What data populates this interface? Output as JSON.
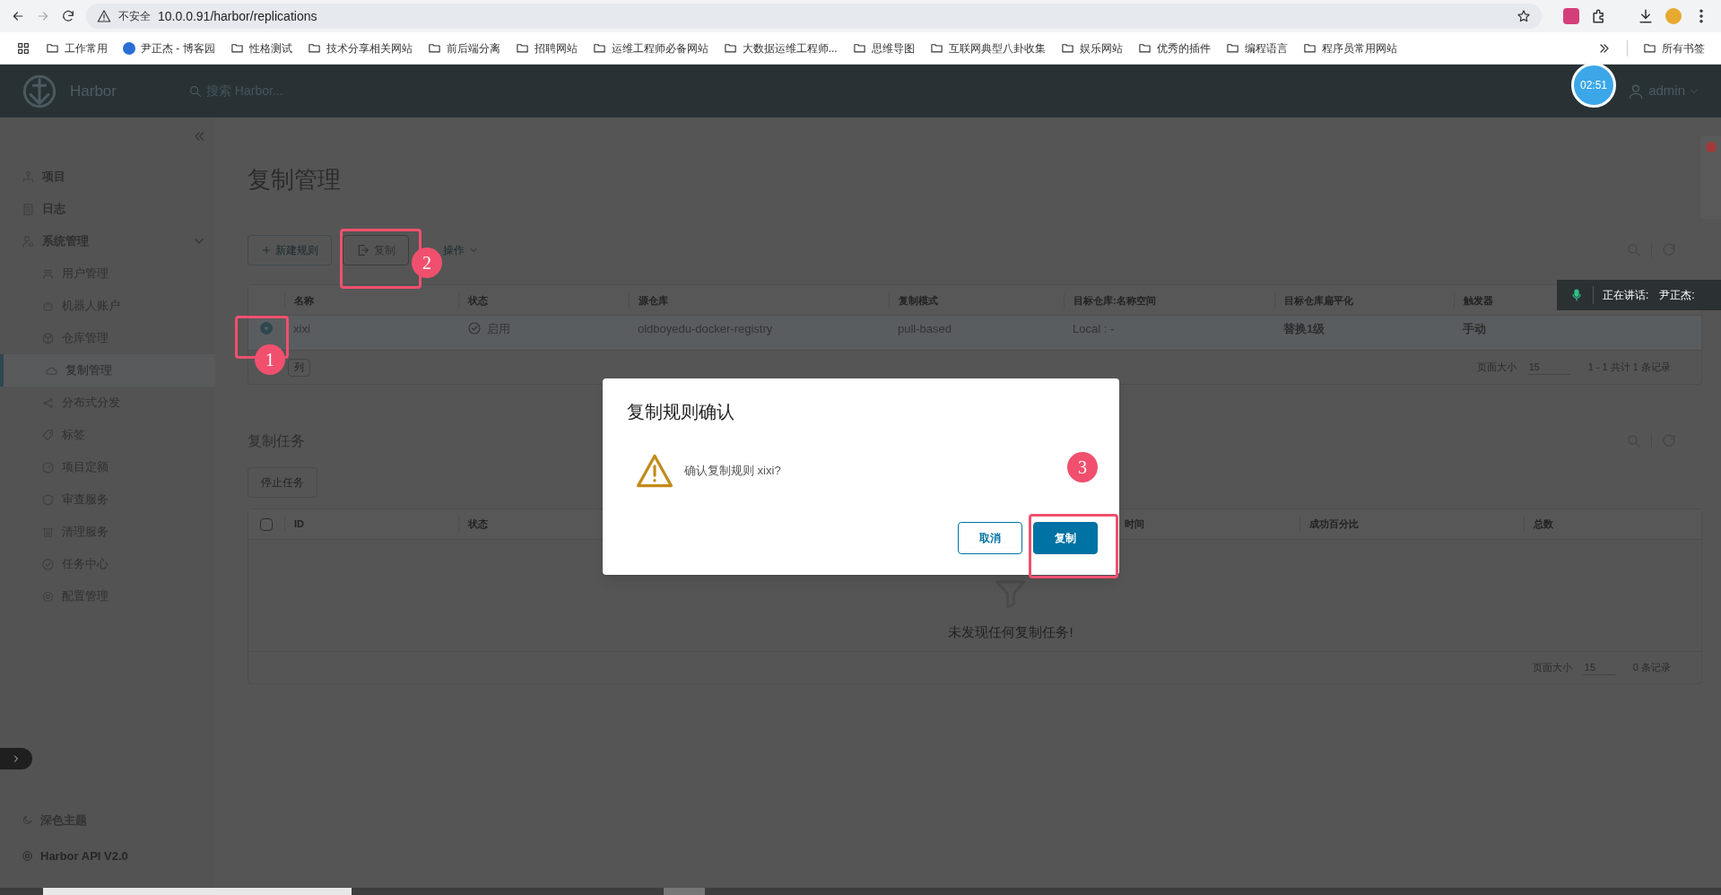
{
  "browser": {
    "warning": "不安全",
    "url": "10.0.0.91/harbor/replications",
    "bookmarks": [
      "工作常用",
      "尹正杰 - 博客园",
      "性格测试",
      "技术分享相关网站",
      "前后端分离",
      "招聘网站",
      "运维工程师必备网站",
      "大数据运维工程师...",
      "思维导图",
      "互联网典型八卦收集",
      "娱乐网站",
      "优秀的插件",
      "编程语言",
      "程序员常用网站"
    ],
    "all_bookmarks": "所有书签"
  },
  "header": {
    "brand": "Harbor",
    "search_placeholder": "搜索 Harbor...",
    "user": "admin",
    "clock": "02:51"
  },
  "sidebar": {
    "items": [
      {
        "label": "项目",
        "selected": false
      },
      {
        "label": "日志",
        "selected": false
      },
      {
        "label": "系统管理",
        "selected": false,
        "expanded": true,
        "children": [
          {
            "label": "用户管理",
            "selected": false
          },
          {
            "label": "机器人账户",
            "selected": false
          },
          {
            "label": "仓库管理",
            "selected": false
          },
          {
            "label": "复制管理",
            "selected": true
          },
          {
            "label": "分布式分发",
            "selected": false
          },
          {
            "label": "标签",
            "selected": false
          },
          {
            "label": "项目定额",
            "selected": false
          },
          {
            "label": "审查服务",
            "selected": false
          },
          {
            "label": "清理服务",
            "selected": false
          },
          {
            "label": "任务中心",
            "selected": false
          },
          {
            "label": "配置管理",
            "selected": false
          }
        ]
      }
    ],
    "drawer_open": false,
    "theme_toggle": "深色主题",
    "api_link": "Harbor API V2.0"
  },
  "page": {
    "title": "复制管理",
    "new_rule": "新建规则",
    "replicate": "复制",
    "actions": "操作"
  },
  "rules_table": {
    "columns": [
      "名称",
      "状态",
      "源仓库",
      "复制模式",
      "目标仓库:名称空间",
      "目标仓库扁平化",
      "触发器"
    ],
    "rows": [
      {
        "selected": true,
        "name": "xixi",
        "status": "启用",
        "source": "oldboyedu-docker-registry",
        "mode": "pull-based",
        "target": "Local : -",
        "flattening": "替换1级",
        "trigger": "手动"
      }
    ],
    "column_button": "列",
    "page_size_label": "页面大小",
    "page_size": "15",
    "summary": "1 - 1 共计 1 条记录"
  },
  "tasks": {
    "title": "复制任务",
    "stop_button": "停止任务",
    "select_all_checked": false,
    "columns": [
      "ID",
      "状态",
      "时间",
      "成功百分比",
      "总数"
    ],
    "empty_text": "未发现任何复制任务!",
    "page_size_label": "页面大小",
    "page_size": "15",
    "summary": "0 条记录"
  },
  "dialog": {
    "title": "复制规则确认",
    "message": "确认复制规则 xixi?",
    "buttons": [
      {
        "label": "取消",
        "kind": "outline"
      },
      {
        "label": "复制",
        "kind": "primary"
      }
    ]
  },
  "annotations": [
    "1",
    "2",
    "3"
  ],
  "speaking_toast": {
    "label": "正在讲话:",
    "speaker": "尹正杰:"
  }
}
